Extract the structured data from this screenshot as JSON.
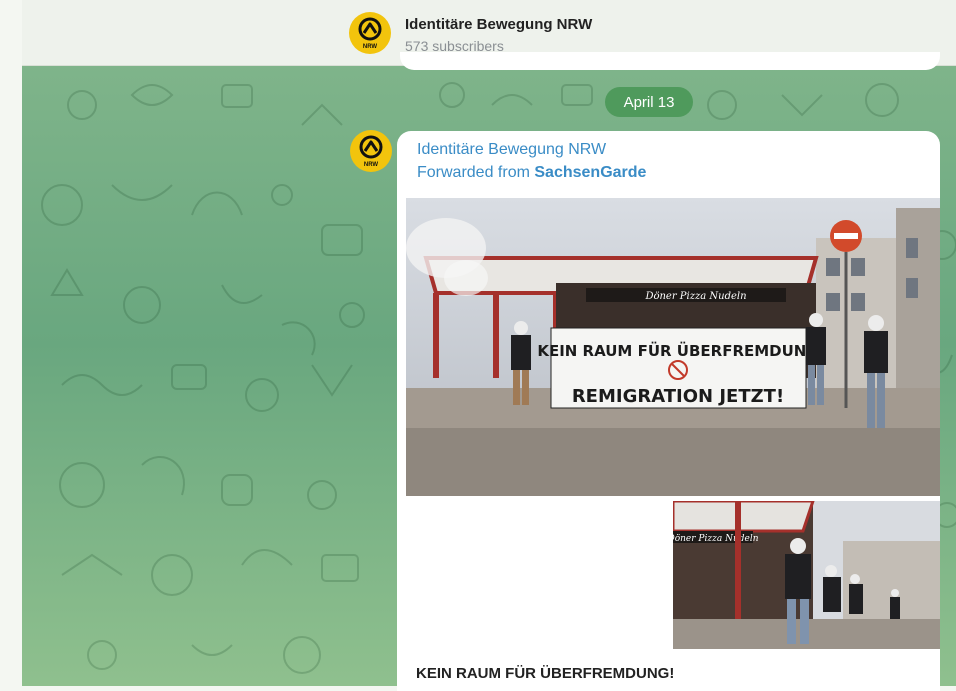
{
  "header": {
    "channel_name": "Identitäre Bewegung NRW",
    "subscribers": "573 subscribers",
    "avatar_label": "NRW"
  },
  "date_separator": "April 13",
  "message": {
    "sender": "Identitäre Bewegung NRW",
    "forwarded_prefix": "Forwarded from ",
    "forwarded_source": "SachsenGarde",
    "photo_main": {
      "banner_line1": "KEIN RAUM FÜR ÜBERFREMDUNG",
      "banner_line2": "REMIGRATION JETZT!",
      "shop_sign": "Döner  Pizza  Nudeln"
    },
    "photo_second": {
      "shop_sign": "Döner  Pizza  Nudeln"
    },
    "caption": "KEIN RAUM FÜR ÜBERFREMDUNG!"
  },
  "colors": {
    "accent_link": "#3a8cc6",
    "date_pill": "#4f9a5c",
    "avatar": "#f2c40d",
    "chat_background": "#7fb48a"
  },
  "icons": [
    "lambda-logo-icon"
  ]
}
